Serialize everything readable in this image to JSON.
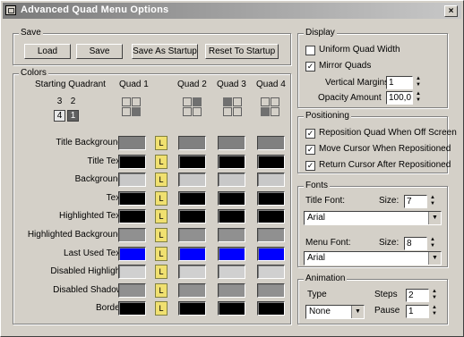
{
  "window": {
    "title": "Advanced Quad Menu Options",
    "close_glyph": "×"
  },
  "save": {
    "legend": "Save",
    "load_label": "Load",
    "save_label": "Save",
    "save_startup_label": "Save As Startup",
    "reset_startup_label": "Reset To Startup"
  },
  "colors": {
    "legend": "Colors",
    "starting_quadrant_label": "Starting Quadrant",
    "quadrant_numbers": [
      "3",
      "2",
      "4",
      "1"
    ],
    "quad_headers": [
      "Quad 1",
      "Quad 2",
      "Quad 3",
      "Quad 4"
    ],
    "lock_glyph": "L",
    "rows": [
      {
        "label": "Title Background",
        "colors": [
          "#808080",
          "#808080",
          "#808080",
          "#808080"
        ]
      },
      {
        "label": "Title Text",
        "colors": [
          "#000000",
          "#000000",
          "#000000",
          "#000000"
        ]
      },
      {
        "label": "Background",
        "colors": [
          "#c8c8c8",
          "#c8c8c8",
          "#c8c8c8",
          "#c8c8c8"
        ]
      },
      {
        "label": "Text",
        "colors": [
          "#000000",
          "#000000",
          "#000000",
          "#000000"
        ]
      },
      {
        "label": "Highlighted Text",
        "colors": [
          "#000000",
          "#000000",
          "#000000",
          "#000000"
        ]
      },
      {
        "label": "Highlighted Background",
        "colors": [
          "#909090",
          "#909090",
          "#909090",
          "#909090"
        ]
      },
      {
        "label": "Last Used Text",
        "colors": [
          "#0000ff",
          "#0000ff",
          "#0000ff",
          "#0000ff"
        ]
      },
      {
        "label": "Disabled Highlight",
        "colors": [
          "#d0d0d0",
          "#d0d0d0",
          "#d0d0d0",
          "#d0d0d0"
        ]
      },
      {
        "label": "Disabled Shadow",
        "colors": [
          "#909090",
          "#909090",
          "#909090",
          "#909090"
        ]
      },
      {
        "label": "Border",
        "colors": [
          "#000000",
          "#000000",
          "#000000",
          "#000000"
        ]
      }
    ]
  },
  "display": {
    "legend": "Display",
    "uniform_quad_width": "Uniform Quad Width",
    "uniform_checked": false,
    "mirror_quads": "Mirror Quads",
    "mirror_checked": true,
    "vertical_margins_label": "Vertical Margins",
    "vertical_margins_value": "1",
    "opacity_label": "Opacity Amount",
    "opacity_value": "100,0"
  },
  "positioning": {
    "legend": "Positioning",
    "reposition": "Reposition Quad When Off Screen",
    "move_cursor": "Move Cursor When Repositioned",
    "return_cursor": "Return Cursor After Repositioned",
    "check_glyph": "✓"
  },
  "fonts": {
    "legend": "Fonts",
    "title_font_label": "Title Font:",
    "size_label": "Size:",
    "title_size": "7",
    "title_font": "Arial",
    "menu_font_label": "Menu Font:",
    "menu_size": "8",
    "menu_font": "Arial"
  },
  "animation": {
    "legend": "Animation",
    "type_label": "Type",
    "type_value": "None",
    "steps_label": "Steps",
    "steps_value": "2",
    "pause_label": "Pause",
    "pause_value": "1"
  },
  "glyphs": {
    "dropdown": "▼",
    "up": "▲",
    "down": "▼"
  }
}
